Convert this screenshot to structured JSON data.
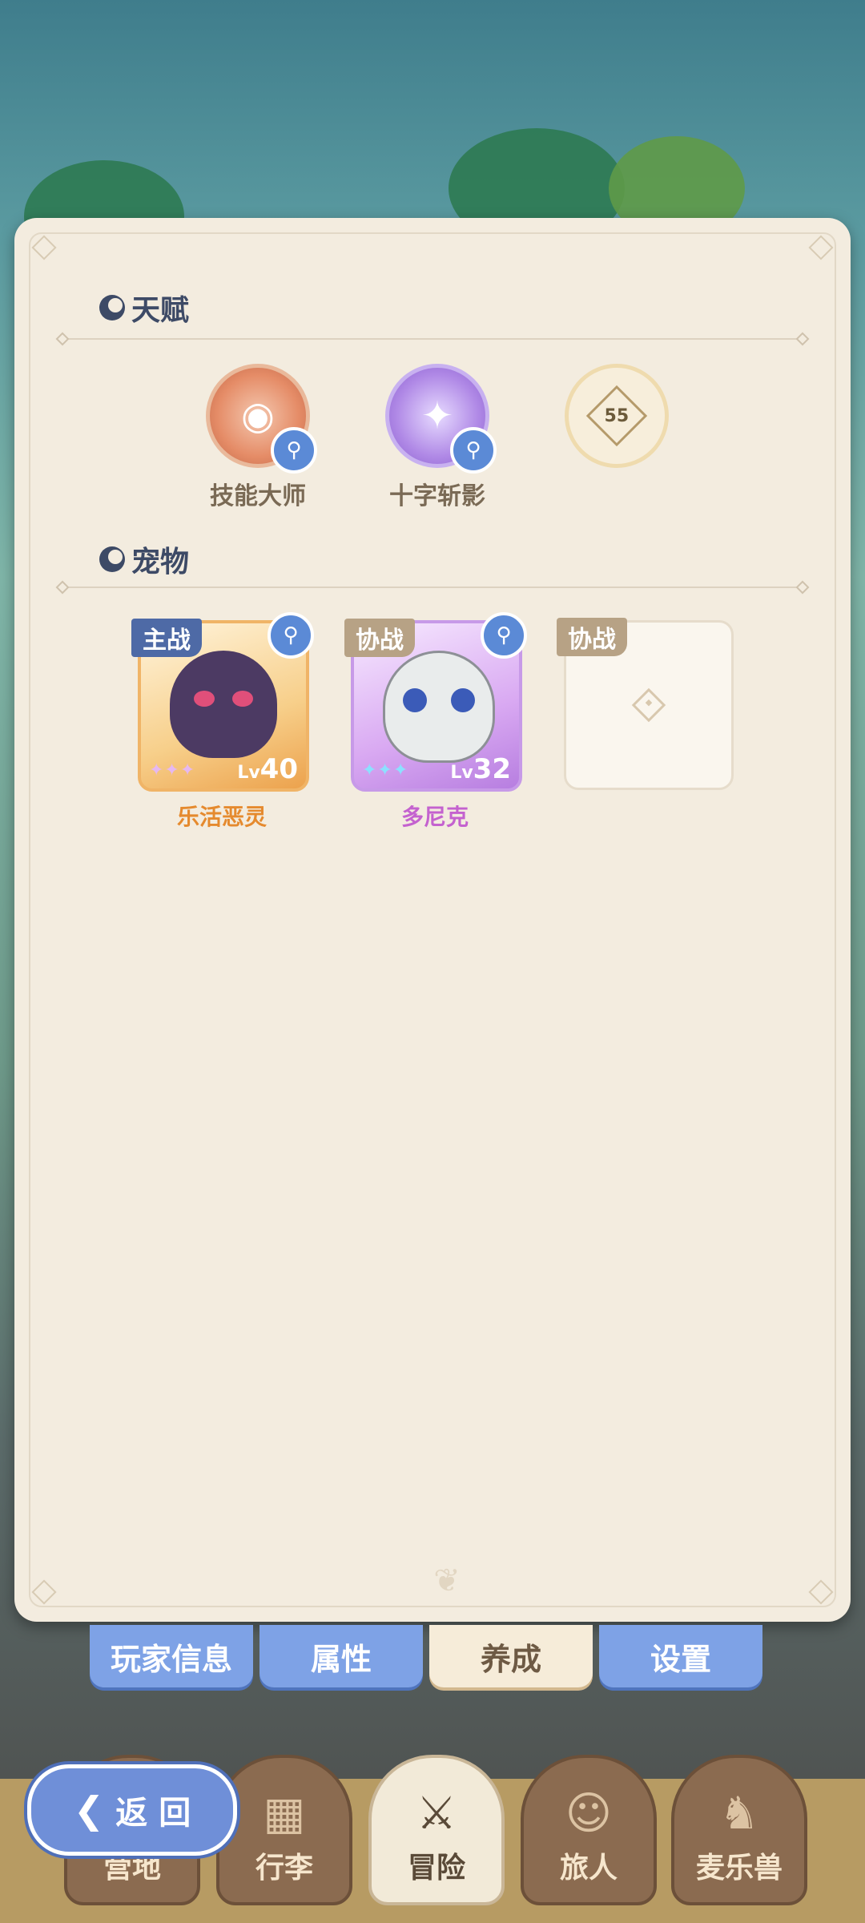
{
  "sections": {
    "talent": {
      "title": "天赋"
    },
    "pets": {
      "title": "宠物"
    }
  },
  "talents": [
    {
      "name": "技能大师",
      "icon": "eye-badge-icon",
      "color": "#e58c67"
    },
    {
      "name": "十字斩影",
      "icon": "crystal-badge-icon",
      "color": "#b089e6"
    },
    {
      "name": "",
      "icon": "locked-badge-icon",
      "unlock_level": "55"
    }
  ],
  "pets": [
    {
      "tag": "主战",
      "name": "乐活恶灵",
      "stars": "✦✦✦",
      "lv_label": "Lv",
      "level": "40"
    },
    {
      "tag": "协战",
      "name": "多尼克",
      "stars": "✦✦✦",
      "lv_label": "Lv",
      "level": "32"
    },
    {
      "tag": "协战",
      "name": ""
    }
  ],
  "tabs": [
    "玩家信息",
    "属性",
    "养成",
    "设置"
  ],
  "active_tab": "养成",
  "bottom_nav": [
    {
      "label": "营地",
      "icon": "camp-icon"
    },
    {
      "label": "行李",
      "icon": "bag-icon"
    },
    {
      "label": "冒险",
      "icon": "swords-icon"
    },
    {
      "label": "旅人",
      "icon": "traveler-icon"
    },
    {
      "label": "麦乐兽",
      "icon": "beast-icon"
    }
  ],
  "back_button": {
    "label": "返 回"
  },
  "colors": {
    "tab_blue": "#7ea2e6",
    "accent_navy": "#3d4a66",
    "pet_orange": "#e58a2e",
    "pet_purple": "#c462cf"
  }
}
